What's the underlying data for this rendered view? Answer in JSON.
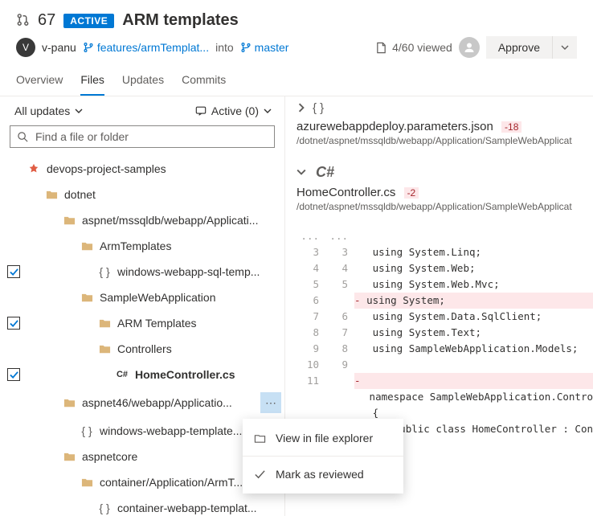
{
  "header": {
    "pr_number": "67",
    "status": "ACTIVE",
    "title": "ARM templates",
    "avatar_initial": "V",
    "user": "v-panu",
    "source_branch": "features/armTemplat...",
    "into": "into",
    "target_branch": "master",
    "viewed": "4/60 viewed",
    "approve": "Approve"
  },
  "tabs": {
    "overview": "Overview",
    "files": "Files",
    "updates": "Updates",
    "commits": "Commits"
  },
  "left": {
    "all_updates": "All updates",
    "active_count": "Active (0)",
    "search_placeholder": "Find a file or folder"
  },
  "tree": {
    "n0": "devops-project-samples",
    "n1": "dotnet",
    "n2": "aspnet/mssqldb/webapp/Applicati...",
    "n3": "ArmTemplates",
    "n4": "windows-webapp-sql-temp...",
    "n5": "SampleWebApplication",
    "n6": "ARM Templates",
    "n7": "Controllers",
    "n8": "HomeController.cs",
    "n9": "aspnet46/webapp/Applicatio...",
    "n10": "windows-webapp-template....",
    "n11": "aspnetcore",
    "n12": "container/Application/ArmT...",
    "n13": "container-webapp-templat..."
  },
  "ctx": {
    "view": "View in file explorer",
    "mark": "Mark as reviewed"
  },
  "file1": {
    "name": "azurewebappdeploy.parameters.json",
    "delta": "-18",
    "path": "/dotnet/aspnet/mssqldb/webapp/Application/SampleWebApplicat"
  },
  "file2": {
    "lang": "C#",
    "name": "HomeController.cs",
    "delta": "-2",
    "path": "/dotnet/aspnet/mssqldb/webapp/Application/SampleWebApplicat"
  },
  "diff": {
    "l0a": "...",
    "l0b": "...",
    "l1a": "3",
    "l1b": "3",
    "c1": "   using System.Linq;",
    "l2a": "4",
    "l2b": "4",
    "c2": "   using System.Web;",
    "l3a": "5",
    "l3b": "5",
    "c3": "   using System.Web.Mvc;",
    "l4a": "6",
    "l4b": "",
    "c4": "using System;",
    "l5a": "7",
    "l5b": "6",
    "c5": "   using System.Data.SqlClient;",
    "l6a": "8",
    "l6b": "7",
    "c6": "   using System.Text;",
    "l7a": "9",
    "l7b": "8",
    "c7": "   using SampleWebApplication.Models;",
    "l8a": "10",
    "l8b": "9",
    "c8": "",
    "l9a": "11",
    "l9b": "",
    "c9": "",
    "l10b": "",
    "c10": "   namespace SampleWebApplication.Contro",
    "l11b": "",
    "c11": "   {",
    "l12b": "",
    "c12": "       public class HomeController : Con"
  }
}
